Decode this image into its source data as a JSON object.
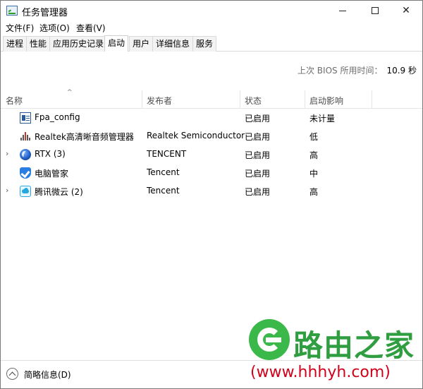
{
  "window": {
    "title": "任务管理器",
    "controls": {
      "minimize": "",
      "maximize": "",
      "close": "✕"
    }
  },
  "menubar": {
    "items": [
      {
        "label": "文件(F)"
      },
      {
        "label": "选项(O)"
      },
      {
        "label": "查看(V)"
      }
    ]
  },
  "tabs": [
    {
      "label": "进程",
      "active": false
    },
    {
      "label": "性能",
      "active": false
    },
    {
      "label": "应用历史记录",
      "active": false
    },
    {
      "label": "启动",
      "active": true
    },
    {
      "label": "用户",
      "active": false
    },
    {
      "label": "详细信息",
      "active": false
    },
    {
      "label": "服务",
      "active": false
    }
  ],
  "bios": {
    "label": "上次 BIOS 所用时间：",
    "value": "10.9 秒"
  },
  "table": {
    "sort_indicator": "^",
    "columns": [
      "名称",
      "发布者",
      "状态",
      "启动影响"
    ],
    "rows": [
      {
        "icon": "fpa-config-icon",
        "expandable": false,
        "name": "Fpa_config",
        "publisher": "",
        "status": "已启用",
        "impact": "未计量"
      },
      {
        "icon": "realtek-audio-icon",
        "expandable": false,
        "name": "Realtek高清晰音频管理器",
        "publisher": "Realtek Semiconductor",
        "status": "已启用",
        "impact": "低"
      },
      {
        "icon": "rtx-icon",
        "expandable": true,
        "name": "RTX (3)",
        "publisher": "TENCENT",
        "status": "已启用",
        "impact": "高"
      },
      {
        "icon": "pc-manager-shield-icon",
        "expandable": false,
        "name": "电脑管家",
        "publisher": "Tencent",
        "status": "已启用",
        "impact": "中"
      },
      {
        "icon": "weiyun-cloud-icon",
        "expandable": true,
        "name": "腾讯微云 (2)",
        "publisher": "Tencent",
        "status": "已启用",
        "impact": "高"
      }
    ]
  },
  "bottom": {
    "fewer_details": "简略信息(D)"
  },
  "watermark": {
    "brand": "路由之家",
    "url": "(www.hhhyh.com)"
  }
}
